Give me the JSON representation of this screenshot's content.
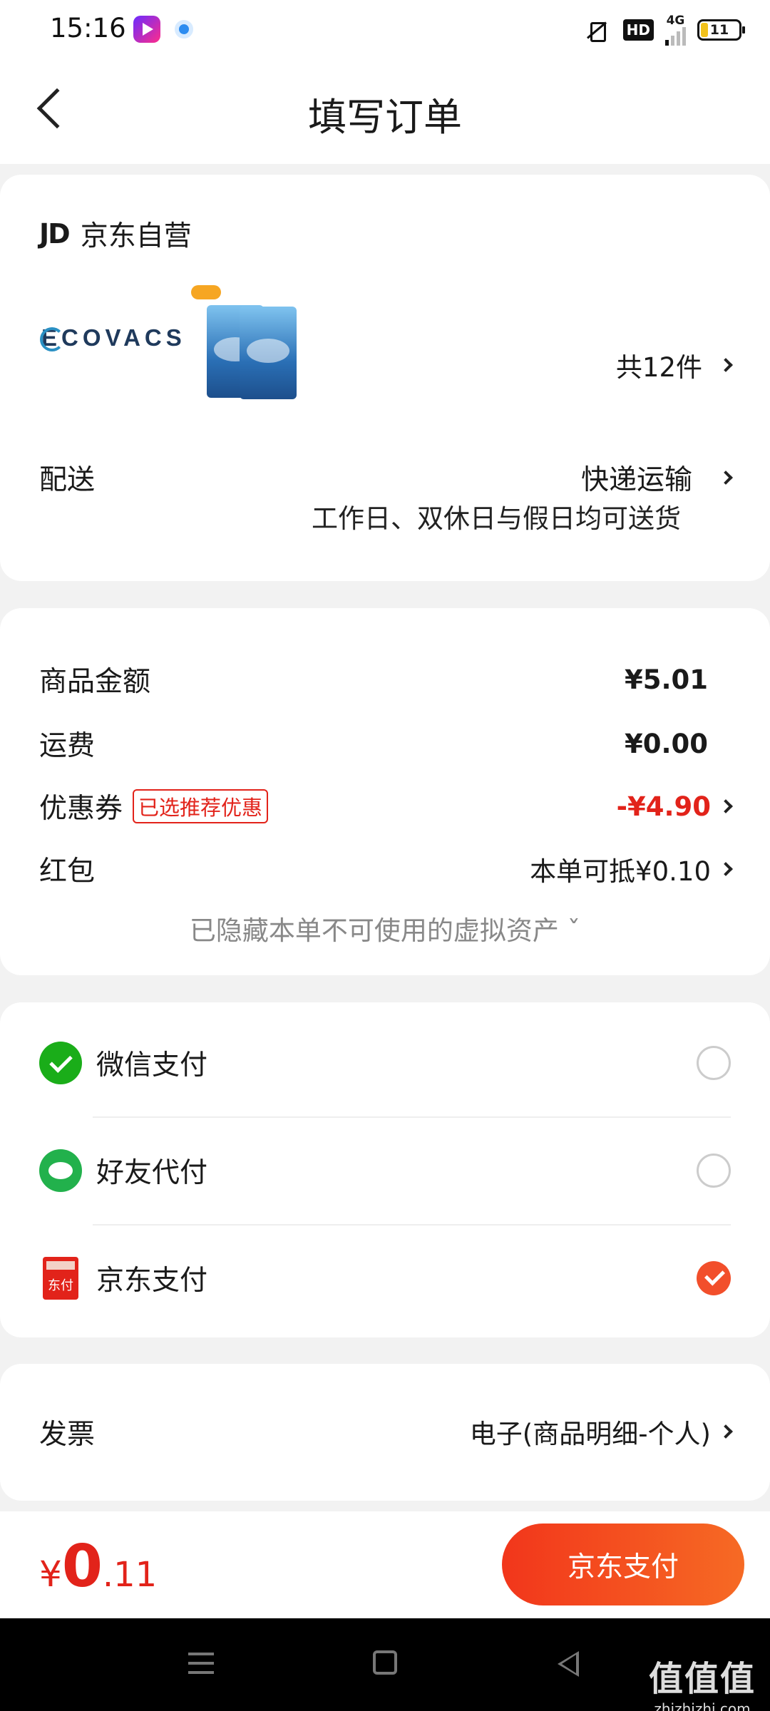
{
  "status_bar": {
    "time": "15:16",
    "hd": "HD",
    "network": "4G",
    "battery": "11"
  },
  "header": {
    "title": "填写订单"
  },
  "store": {
    "logo_text": "JD",
    "name": "京东自营"
  },
  "product": {
    "brand_logo": "ECOVACS",
    "count_label": "共12件"
  },
  "delivery": {
    "label": "配送",
    "method": "快递运输",
    "note": "工作日、双休日与假日均可送货"
  },
  "summary": {
    "goods_label": "商品金额",
    "goods_value": "¥5.01",
    "shipping_label": "运费",
    "shipping_value": "¥0.00",
    "coupon_label": "优惠券",
    "coupon_tag": "已选推荐优惠",
    "coupon_value": "-¥4.90",
    "redpacket_label": "红包",
    "redpacket_value": "本单可抵¥0.10",
    "hidden_note": "已隐藏本单不可使用的虚拟资产 ˇ"
  },
  "payment": {
    "options": [
      {
        "label": "微信支付",
        "icon": "wechat-pay-icon",
        "selected": false
      },
      {
        "label": "好友代付",
        "icon": "friend-pay-icon",
        "selected": false
      },
      {
        "label": "京东支付",
        "icon": "jd-pay-icon",
        "selected": true
      }
    ],
    "jd_icon_text": "东付"
  },
  "invoice": {
    "label": "发票",
    "value": "电子(商品明细-个人)"
  },
  "footer": {
    "currency": "¥",
    "total_int": "0",
    "total_dec": ".11",
    "submit_label": "京东支付"
  },
  "watermark": {
    "main": "值值值",
    "sub": "zhizhizhi.com"
  },
  "colors": {
    "accent_red": "#e2231a",
    "button_gradient_start": "#f2361b",
    "button_gradient_end": "#f66a24"
  }
}
